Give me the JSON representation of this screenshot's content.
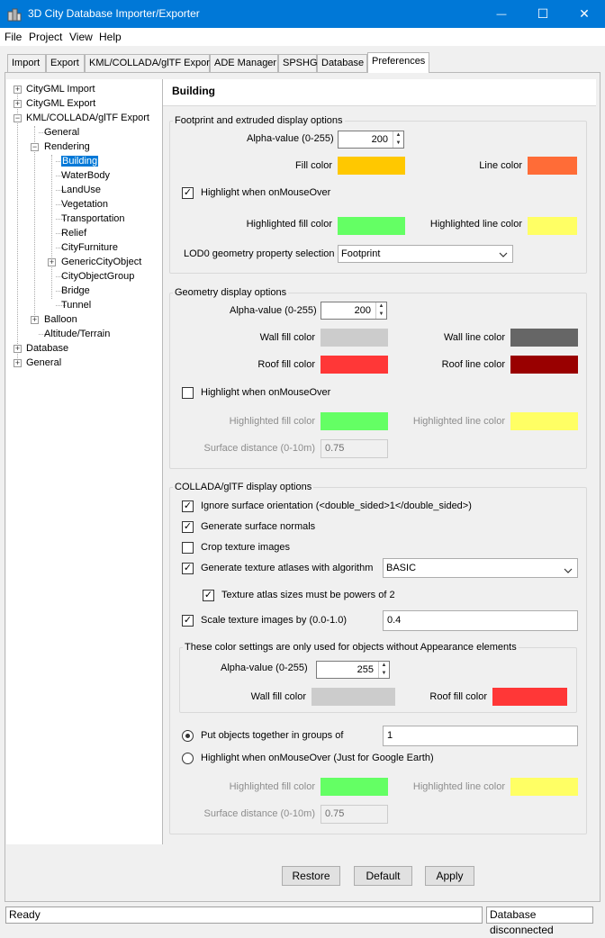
{
  "window": {
    "title": "3D City Database Importer/Exporter",
    "controls": {
      "minimize": "—",
      "maximize": "☐",
      "close": "✕"
    }
  },
  "menu": [
    "File",
    "Project",
    "View",
    "Help"
  ],
  "tabs": [
    "Import",
    "Export",
    "KML/COLLADA/glTF Export",
    "ADE Manager",
    "SPSHG",
    "Database",
    "Preferences"
  ],
  "active_tab": "Preferences",
  "tree": [
    {
      "label": "CityGML Import"
    },
    {
      "label": "CityGML Export"
    },
    {
      "label": "KML/COLLADA/glTF Export"
    },
    {
      "label": "General"
    },
    {
      "label": "Rendering"
    },
    {
      "label": "Building"
    },
    {
      "label": "WaterBody"
    },
    {
      "label": "LandUse"
    },
    {
      "label": "Vegetation"
    },
    {
      "label": "Transportation"
    },
    {
      "label": "Relief"
    },
    {
      "label": "CityFurniture"
    },
    {
      "label": "GenericCityObject"
    },
    {
      "label": "CityObjectGroup"
    },
    {
      "label": "Bridge"
    },
    {
      "label": "Tunnel"
    },
    {
      "label": "Balloon"
    },
    {
      "label": "Altitude/Terrain"
    },
    {
      "label": "Database"
    },
    {
      "label": "General"
    }
  ],
  "panel": {
    "title": "Building",
    "footprint": {
      "legend": "Footprint and extruded display options",
      "alpha_label": "Alpha-value (0-255)",
      "alpha_value": "200",
      "fill_color_label": "Fill color",
      "fill_color": "#ffc800",
      "line_color_label": "Line color",
      "line_color": "#ff6c37",
      "highlight_label": "Highlight when onMouseOver",
      "highlight_checked": true,
      "hl_fill_label": "Highlighted fill color",
      "hl_fill_color": "#64ff64",
      "hl_line_label": "Highlighted line color",
      "hl_line_color": "#ffff64",
      "lod0_label": "LOD0 geometry property selection",
      "lod0_value": "Footprint"
    },
    "geometry": {
      "legend": "Geometry display options",
      "alpha_label": "Alpha-value (0-255)",
      "alpha_value": "200",
      "wall_fill_label": "Wall fill color",
      "wall_fill_color": "#cccccc",
      "wall_line_label": "Wall line color",
      "wall_line_color": "#666666",
      "roof_fill_label": "Roof fill color",
      "roof_fill_color": "#ff3737",
      "roof_line_label": "Roof line color",
      "roof_line_color": "#990000",
      "highlight_label": "Highlight when onMouseOver",
      "highlight_checked": false,
      "hl_fill_label": "Highlighted fill color",
      "hl_fill_color": "#64ff64",
      "hl_line_label": "Highlighted line color",
      "hl_line_color": "#ffff64",
      "surface_label": "Surface distance (0-10m)",
      "surface_value": "0.75"
    },
    "collada": {
      "legend": "COLLADA/glTF display options",
      "ignore_label": "Ignore surface orientation (<double_sided>1</double_sided>)",
      "normals_label": "Generate surface normals",
      "crop_label": "Crop texture images",
      "atlas_label": "Generate texture atlases with algorithm",
      "atlas_value": "BASIC",
      "pow2_label": "Texture atlas sizes must be powers of 2",
      "scale_label": "Scale texture images by (0.0-1.0)",
      "scale_value": "0.4",
      "sub_legend": "These color settings are only used for objects without Appearance elements",
      "alpha_label": "Alpha-value (0-255)",
      "alpha_value": "255",
      "wall_fill_label": "Wall fill color",
      "wall_fill_color": "#cccccc",
      "roof_fill_label": "Roof fill color",
      "roof_fill_color": "#ff3737",
      "group_label": "Put objects together in groups of",
      "group_value": "1",
      "highlight_label": "Highlight when onMouseOver (Just for Google Earth)",
      "hl_fill_label": "Highlighted fill color",
      "hl_fill_color": "#64ff64",
      "hl_line_label": "Highlighted line color",
      "hl_line_color": "#ffff64",
      "surface_label": "Surface distance (0-10m)",
      "surface_value": "0.75"
    },
    "buttons": {
      "restore": "Restore",
      "default": "Default",
      "apply": "Apply"
    }
  },
  "status": {
    "left": "Ready",
    "right": "Database disconnected"
  }
}
